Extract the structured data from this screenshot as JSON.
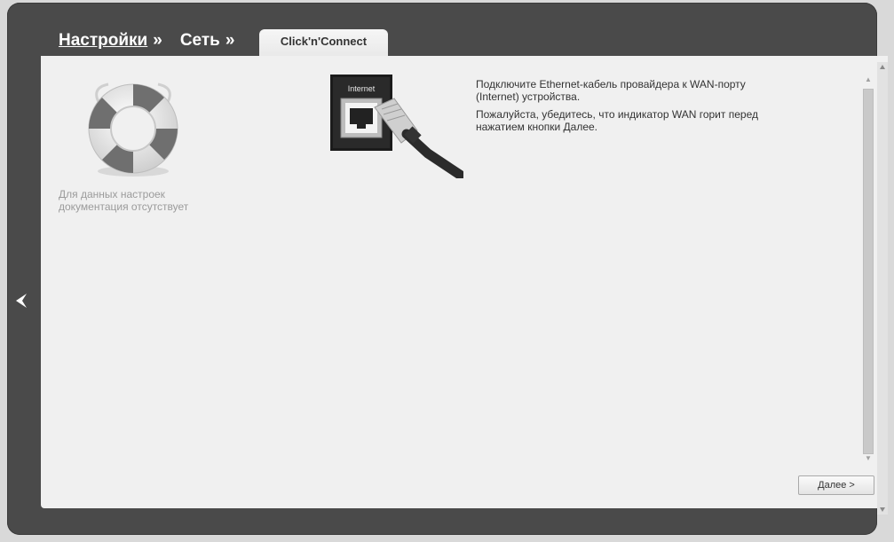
{
  "breadcrumb": {
    "settings": "Настройки",
    "sep1": "»",
    "network": "Сеть",
    "sep2": "»"
  },
  "tab": {
    "label": "Click'n'Connect"
  },
  "help": {
    "text_line1": "Для данных настроек",
    "text_line2": "документация отсутствует"
  },
  "port_image": {
    "label": "Internet"
  },
  "instructions": {
    "p1": "Подключите Ethernet-кабель провайдера к WAN-порту (Internet) устройства.",
    "p2": "Пожалуйста, убедитесь, что индикатор WAN горит перед нажатием кнопки Далее."
  },
  "buttons": {
    "next": "Далее >"
  },
  "icons": {
    "lifebuoy": "lifebuoy-icon",
    "back": "back-arrow-icon"
  },
  "colors": {
    "frame": "#4a4a4a",
    "panel": "#f0f0f0",
    "help_text": "#9b9b9b"
  }
}
